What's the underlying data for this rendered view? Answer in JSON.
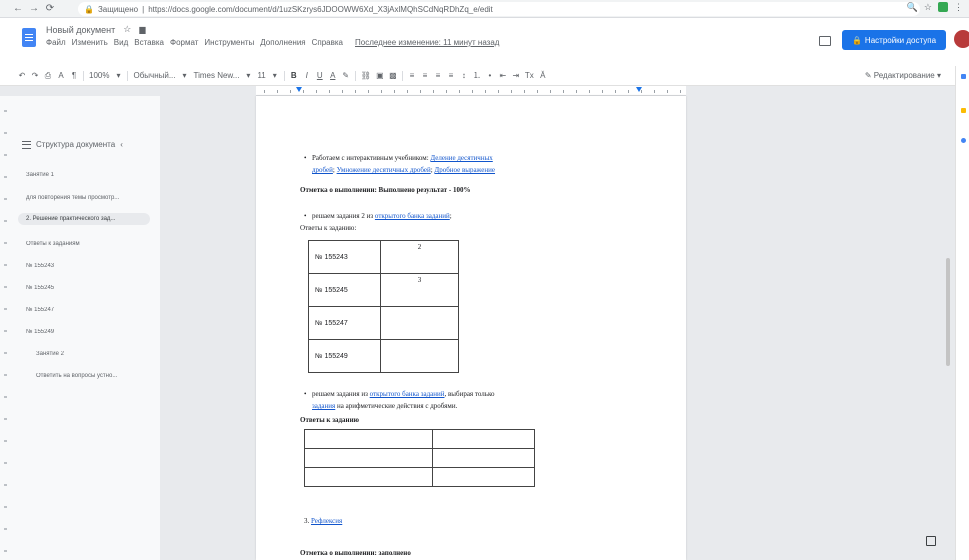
{
  "browser": {
    "secure_label": "Защищено",
    "url": "https://docs.google.com/document/d/1uzSKzrys6JDOOWW6Xd_X3jAxlMQhSCdNqRDhZq_e/edit"
  },
  "doc": {
    "title": "Новый документ",
    "star_icon": "star-icon",
    "menus": [
      "Файл",
      "Изменить",
      "Вид",
      "Вставка",
      "Формат",
      "Инструменты",
      "Дополнения",
      "Справка"
    ],
    "last_edit": "Последнее изменение: 11 минут назад",
    "share_label": "Настройки доступа",
    "editing_mode": "Редактирование"
  },
  "toolbar": {
    "zoom": "100%",
    "style": "Обычный...",
    "font": "Times New...",
    "size": "11",
    "items": [
      "↶",
      "↷",
      "🖶",
      "A",
      "⊞"
    ]
  },
  "outline": {
    "title": "Структура документа",
    "items": [
      {
        "text": "Занятие 1",
        "level": 1
      },
      {
        "text": "для повторения темы просмотр...",
        "level": 1
      },
      {
        "text": "2. Решение практического зад...",
        "level": 1,
        "active": true
      },
      {
        "text": "Ответы к заданиям",
        "level": 1
      },
      {
        "text": "№ 155243",
        "level": 1
      },
      {
        "text": "№ 155245",
        "level": 1
      },
      {
        "text": "№ 155247",
        "level": 1
      },
      {
        "text": "№ 155249",
        "level": 1
      },
      {
        "text": "Занятие 2",
        "level": 2
      },
      {
        "text": "Ответить на вопросы устно...",
        "level": 2
      }
    ]
  },
  "page": {
    "bullet1_text": "Работаем с интерактивным учебником: ",
    "bullet1_link1": "Деление десятичных",
    "bullet1_link2": "дробей",
    "bullet1_sep1": "; ",
    "bullet1_link3": "Умножение десятичных дробей",
    "bullet1_sep2": "; ",
    "bullet1_link4": "Дробное выражение",
    "result_line": "Отметка о выполнении: Выполнено результат - 100%",
    "bullet2_text": "решаем задания 2 из ",
    "bullet2_link": "открытого банка заданий",
    "bullet2_tail": ";",
    "answers_label": "Ответы к заданию:",
    "table1": [
      {
        "num": "№ 155243",
        "answer": "2"
      },
      {
        "num": "№ 155245",
        "answer": "3"
      },
      {
        "num": "№ 155247",
        "answer": ""
      },
      {
        "num": "№ 155249",
        "answer": ""
      }
    ],
    "bullet3_text": "решаем задания из ",
    "bullet3_link": "открытого банка заданий",
    "bullet3_mid": ", выбирая только",
    "bullet3_line2_link": "задания",
    "bullet3_line2_text": " на арифметические действия с дробями.",
    "answers_label2": "Ответы к заданию",
    "section3_num": "3. ",
    "section3_link": "Рефлексия",
    "completion_line": "Отметка о выполнении: заполнено"
  }
}
